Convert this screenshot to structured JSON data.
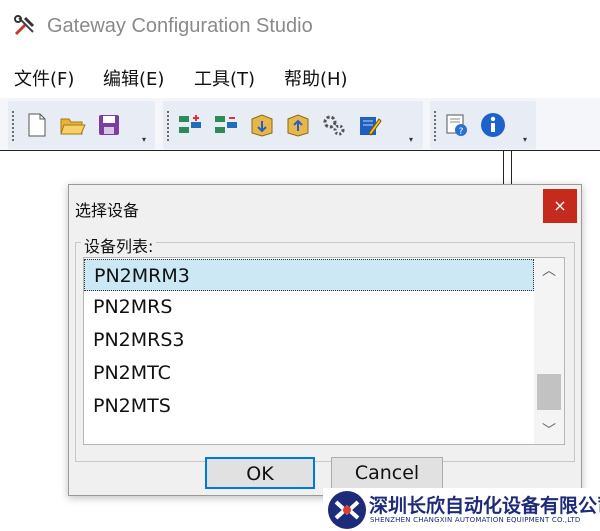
{
  "app": {
    "title": "Gateway Configuration Studio"
  },
  "menu": {
    "items": [
      {
        "label": "文件(F)"
      },
      {
        "label": "编辑(E)"
      },
      {
        "label": "工具(T)"
      },
      {
        "label": "帮助(H)"
      }
    ]
  },
  "toolbar": {
    "groups": [
      {
        "buttons": [
          "new-file-icon",
          "open-folder-icon",
          "save-icon"
        ]
      },
      {
        "buttons": [
          "add-node-icon",
          "remove-node-icon",
          "download-icon",
          "upload-icon",
          "settings-gears-icon",
          "edit-notepad-icon"
        ]
      },
      {
        "buttons": [
          "help-document-icon",
          "info-icon"
        ]
      }
    ]
  },
  "dialog": {
    "title": "选择设备",
    "close_label": "×",
    "group_label": "设备列表:",
    "list": {
      "items": [
        "PN2MRM3",
        "PN2MRS",
        "PN2MRS3",
        "PN2MTC",
        "PN2MTS"
      ],
      "selected": "PN2MRM3"
    },
    "ok_label": "OK",
    "cancel_label": "Cancel"
  },
  "watermark": {
    "company_cn": "深圳长欣自动化设备有限公司",
    "company_en": "SHENZHEN CHANGXIN AUTOMATION EQUIPMENT CO.,LTD"
  },
  "colors": {
    "close": "#c42b1c",
    "selection": "#cce8f4",
    "focus": "#0078d7",
    "brand": "#1d2b7a"
  }
}
